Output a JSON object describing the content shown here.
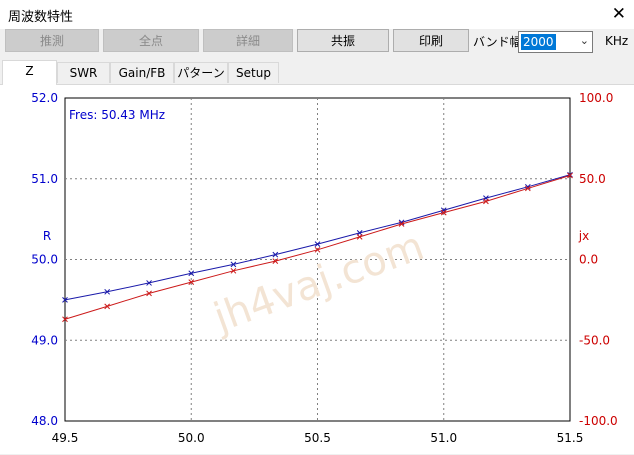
{
  "window": {
    "title": "周波数特性",
    "close_glyph": "✕"
  },
  "toolbar": {
    "buttons": [
      {
        "label": "推測",
        "enabled": false
      },
      {
        "label": "全点",
        "enabled": false
      },
      {
        "label": "詳細",
        "enabled": false
      },
      {
        "label": "共振",
        "enabled": true
      },
      {
        "label": "印刷",
        "enabled": true
      }
    ],
    "band_label": "バンド幅",
    "band_value": "2000",
    "band_unit": "KHz"
  },
  "tabs": [
    "Z",
    "SWR",
    "Gain/FB",
    "パターン",
    "Setup"
  ],
  "active_tab": "Z",
  "chart_data": {
    "type": "line",
    "annotation": "Fres: 50.43 MHz",
    "watermark": "jh4vaj.com",
    "x_ticks": [
      "49.5",
      "50.0",
      "50.5",
      "51.0",
      "51.5"
    ],
    "xlim": [
      49.5,
      51.5
    ],
    "left_axis": {
      "label": "R",
      "ylim": [
        48.0,
        52.0
      ],
      "ticks": [
        "52.0",
        "51.0",
        "50.0",
        "49.0",
        "48.0"
      ],
      "color": "#0000cc"
    },
    "right_axis": {
      "label": "jx",
      "ylim": [
        -100.0,
        100.0
      ],
      "ticks": [
        "100.0",
        "50.0",
        "0.0",
        "-50.0",
        "-100.0"
      ],
      "color": "#cc0000"
    },
    "grid": true,
    "series": [
      {
        "name": "R",
        "axis": "left",
        "color": "#1a1aaa",
        "x": [
          49.5,
          49.667,
          49.833,
          50.0,
          50.167,
          50.333,
          50.5,
          50.667,
          50.833,
          51.0,
          51.167,
          51.333,
          51.5
        ],
        "y": [
          49.5,
          49.6,
          49.71,
          49.83,
          49.94,
          50.06,
          50.19,
          50.33,
          50.46,
          50.61,
          50.76,
          50.9,
          51.05
        ]
      },
      {
        "name": "jx",
        "axis": "right",
        "color": "#cc1a1a",
        "x": [
          49.5,
          49.667,
          49.833,
          50.0,
          50.167,
          50.333,
          50.5,
          50.667,
          50.833,
          51.0,
          51.167,
          51.333,
          51.5
        ],
        "y": [
          -37,
          -29,
          -21,
          -14,
          -7,
          -1,
          6,
          14,
          22,
          29,
          36,
          44,
          52
        ]
      }
    ]
  }
}
